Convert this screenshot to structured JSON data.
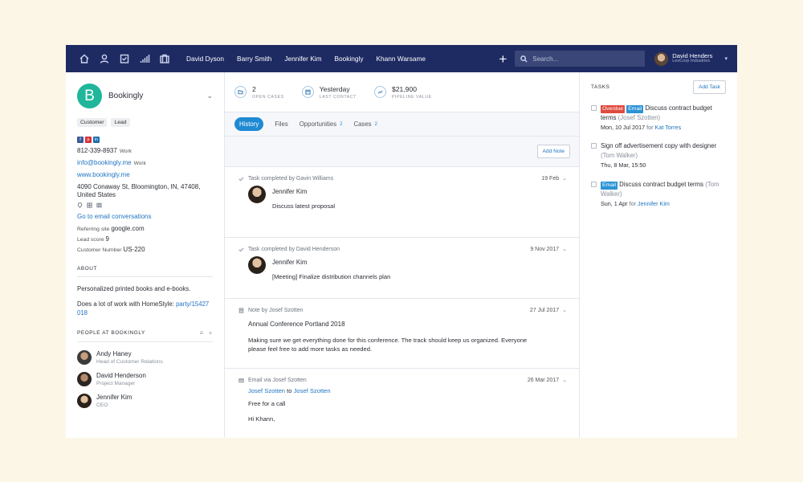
{
  "nav": {
    "icons": [
      "home-icon",
      "contacts-icon",
      "tasks-icon",
      "reports-icon",
      "cases-icon"
    ],
    "recent": [
      "David Dyson",
      "Barry Smith",
      "Jennifer Kim",
      "Bookingly",
      "Khann Warsame"
    ],
    "add_label": "+",
    "search_placeholder": "Search...",
    "user_name": "David Henders",
    "user_company": "LexCorp Industries"
  },
  "company": {
    "logo_letter": "B",
    "name": "Bookingly",
    "tags": [
      "Customer",
      "Lead"
    ],
    "social": [
      {
        "icon": "facebook-icon",
        "glyph": "f",
        "color": "#3b5998"
      },
      {
        "icon": "pinterest-icon",
        "glyph": "p",
        "color": "#d6303a"
      },
      {
        "icon": "linkedin-icon",
        "glyph": "in",
        "color": "#1d6fb0"
      }
    ],
    "phone": "812-339-8937",
    "phone_type": "Work",
    "email": "info@bookingly.me",
    "email_type": "Work",
    "website": "www.bookingly.me",
    "address_line1": "4090 Conaway St, Bloomington, IN, 47408,",
    "address_line2": "United States",
    "email_conversations_link": "Go to email conversations",
    "referring_site_label": "Referring site",
    "referring_site": "google.com",
    "lead_score_label": "Lead score",
    "lead_score": "9",
    "customer_number_label": "Customer Number",
    "customer_number": "US-220"
  },
  "about": {
    "title": "ABOUT",
    "text1": "Personalized printed books and e-books.",
    "text2_prefix": "Does a lot of work with HomeStyle: ",
    "text2_link": "party/15427 018"
  },
  "people": {
    "title": "PEOPLE AT BOOKINGLY",
    "items": [
      {
        "name": "Andy Haney",
        "role": "Head of Customer Relations",
        "bg": "radial-gradient(circle at 50% 40%, #c79e80 0 33%, #3d3a3b 34% 100%)"
      },
      {
        "name": "David Henderson",
        "role": "Project Manager",
        "bg": "radial-gradient(circle at 50% 40%, #b58a6b 0 33%, #2d2522 34% 100%)"
      },
      {
        "name": "Jennifer Kim",
        "role": "CEO",
        "bg": "radial-gradient(circle at 50% 40%, #e2c2a3 0 32%, #2b211b 33% 100%)"
      }
    ]
  },
  "stats": [
    {
      "icon": "folder-icon",
      "value": "2",
      "label": "OPEN CASES"
    },
    {
      "icon": "calendar-icon",
      "value": "Yesterday",
      "label": "LAST CONTACT"
    },
    {
      "icon": "trend-icon",
      "value": "$21,900",
      "label": "PIPELINE VALUE"
    }
  ],
  "tabs": [
    {
      "label": "History",
      "count": ""
    },
    {
      "label": "Files",
      "count": ""
    },
    {
      "label": "Opportunities",
      "count": "2"
    },
    {
      "label": "Cases",
      "count": "2"
    }
  ],
  "add_note_label": "Add Note",
  "feed": {
    "item1": {
      "head": "Task completed by Gavin Williams",
      "date": "19 Feb",
      "person": "Jennifer Kim",
      "text": "Discuss latest proposal"
    },
    "item2": {
      "head": "Task completed by David Henderson",
      "date": "9 Nov 2017",
      "person": "Jennifer Kim",
      "text": "[Meeting] Finalize distribution channels plan"
    },
    "item3": {
      "head": "Note by Josef Szotten",
      "date": "27 Jul 2017",
      "title": "Annual Conference Portland 2018",
      "body": "Making sure we get everything done for this conference. The track should keep us organized. Everyone please feel free to add more tasks as needed."
    },
    "item4": {
      "head": "Email via Josef Szotten",
      "date": "26 Mar 2017",
      "from": "Josef Szotten",
      "to_word": "to",
      "to": "Josef Szotten",
      "subject": "Free for a call",
      "greeting": "Hi Khann,"
    }
  },
  "tasks": {
    "title": "TASKS",
    "add_label": "Add Task",
    "t1": {
      "badge1": "Overdue",
      "badge2": "Email",
      "title": "Discuss contract budget terms",
      "who": "(Josef Szotten)",
      "due": "Mon, 10 Jul 2017",
      "for_word": "for",
      "assignee": "Kat Torres"
    },
    "t2": {
      "title": "Sign off advertisement copy with designer",
      "who": "(Tom Walker)",
      "due": "Thu, 8 Mar, 15:50"
    },
    "t3": {
      "badge": "Email",
      "title": "Discuss contract budget terms",
      "who": "(Tom Walker)",
      "due": "Sun, 1 Apr",
      "for_word": "for",
      "assignee": "Jennifer Kim"
    }
  },
  "colors": {
    "nav_bg": "#1e2b63",
    "accent": "#1f8ad2",
    "company_logo": "#1fb69b",
    "overdue": "#e04b3f"
  }
}
